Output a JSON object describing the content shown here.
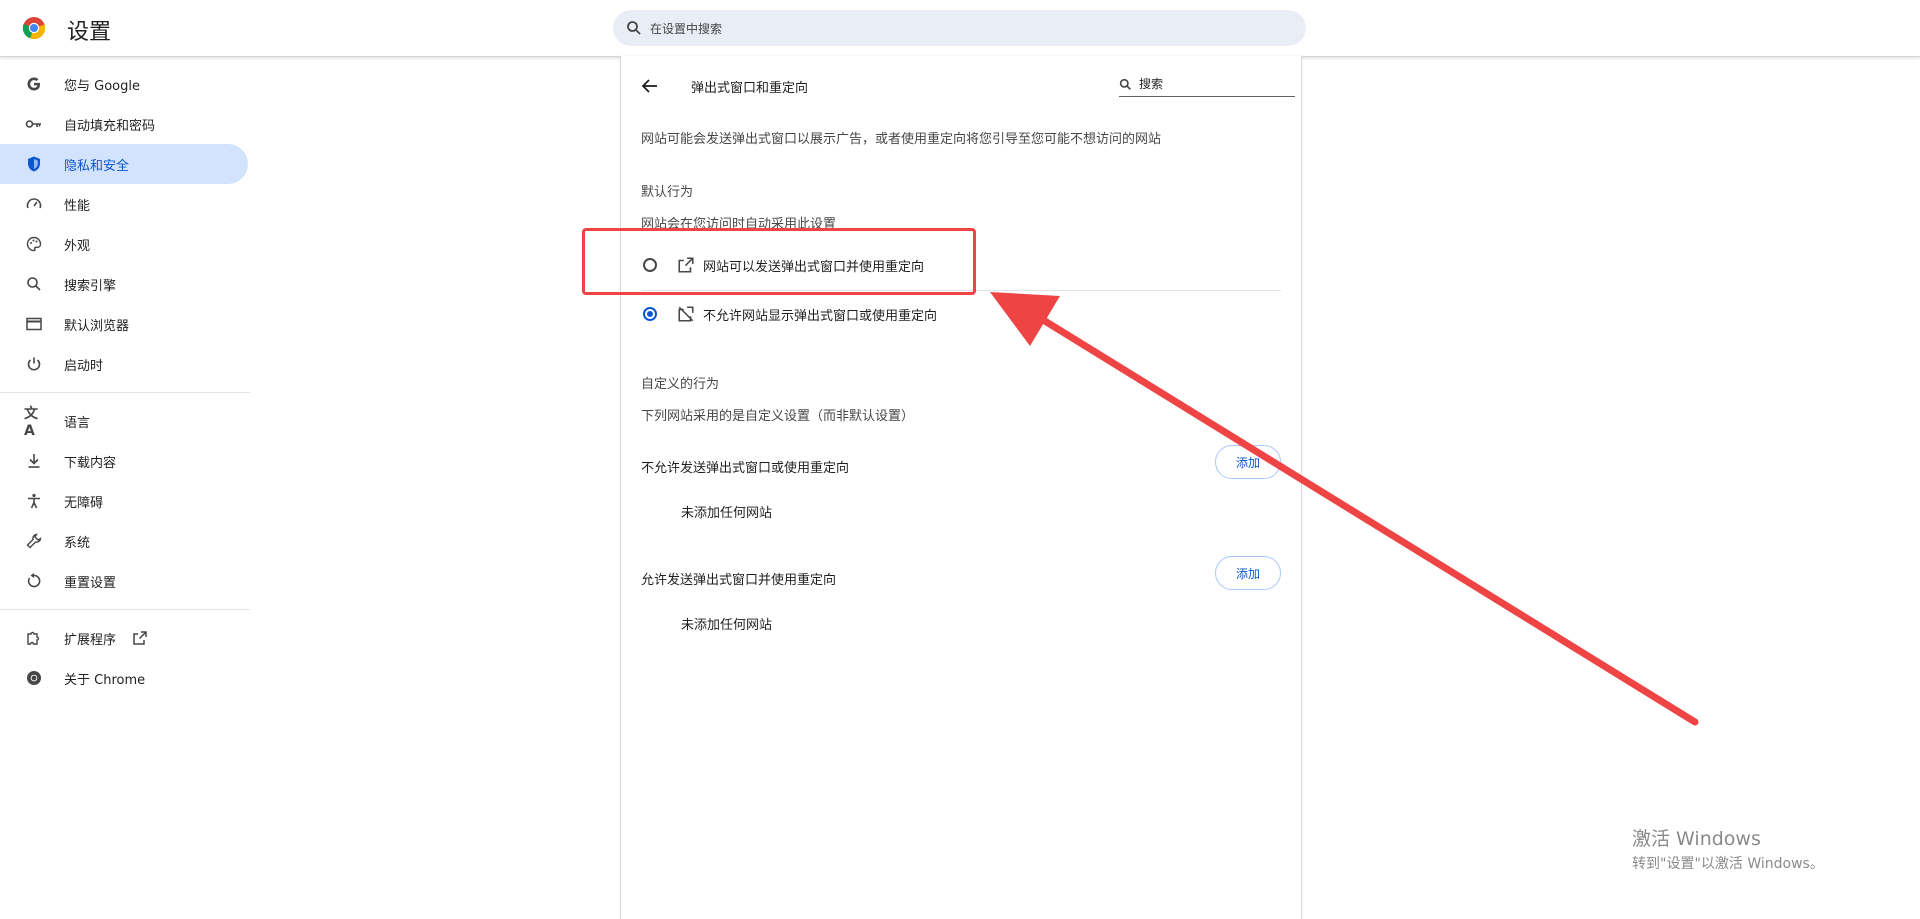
{
  "header": {
    "title": "设置",
    "search_placeholder": "在设置中搜索"
  },
  "sidebar": {
    "items": [
      {
        "label": "您与 Google",
        "icon": "google-g-icon"
      },
      {
        "label": "自动填充和密码",
        "icon": "key-icon"
      },
      {
        "label": "隐私和安全",
        "icon": "shield-icon",
        "active": true
      },
      {
        "label": "性能",
        "icon": "speedometer-icon"
      },
      {
        "label": "外观",
        "icon": "palette-icon"
      },
      {
        "label": "搜索引擎",
        "icon": "search-icon"
      },
      {
        "label": "默认浏览器",
        "icon": "browser-window-icon"
      },
      {
        "label": "启动时",
        "icon": "power-icon"
      },
      {
        "label": "语言",
        "icon": "translate-icon"
      },
      {
        "label": "下载内容",
        "icon": "download-icon"
      },
      {
        "label": "无障碍",
        "icon": "accessibility-icon"
      },
      {
        "label": "系统",
        "icon": "wrench-icon"
      },
      {
        "label": "重置设置",
        "icon": "reset-icon"
      },
      {
        "label": "扩展程序",
        "icon": "puzzle-icon"
      },
      {
        "label": "关于 Chrome",
        "icon": "chrome-icon"
      }
    ]
  },
  "main": {
    "subpage_title": "弹出式窗口和重定向",
    "search_placeholder": "搜索",
    "description": "网站可能会发送弹出式窗口以展示广告，或者使用重定向将您引导至您可能不想访问的网站",
    "default_heading": "默认行为",
    "default_subtext": "网站会在您访问时自动采用此设置",
    "options": [
      {
        "label": "网站可以发送弹出式窗口并使用重定向",
        "checked": false,
        "icon": "open-in-new-icon"
      },
      {
        "label": "不允许网站显示弹出式窗口或使用重定向",
        "checked": true,
        "icon": "popup-blocked-icon"
      }
    ],
    "custom_heading": "自定义的行为",
    "custom_subtext": "下列网站采用的是自定义设置（而非默认设置）",
    "lists": [
      {
        "title": "不允许发送弹出式窗口或使用重定向",
        "button": "添加",
        "empty": "未添加任何网站"
      },
      {
        "title": "允许发送弹出式窗口并使用重定向",
        "button": "添加",
        "empty": "未添加任何网站"
      }
    ]
  },
  "watermark": {
    "line1": "激活 Windows",
    "line2": "转到\"设置\"以激活 Windows。"
  },
  "colors": {
    "accent": "#0b57d0",
    "active_bg": "#d3e3fd",
    "annotation": "#ef4444"
  }
}
